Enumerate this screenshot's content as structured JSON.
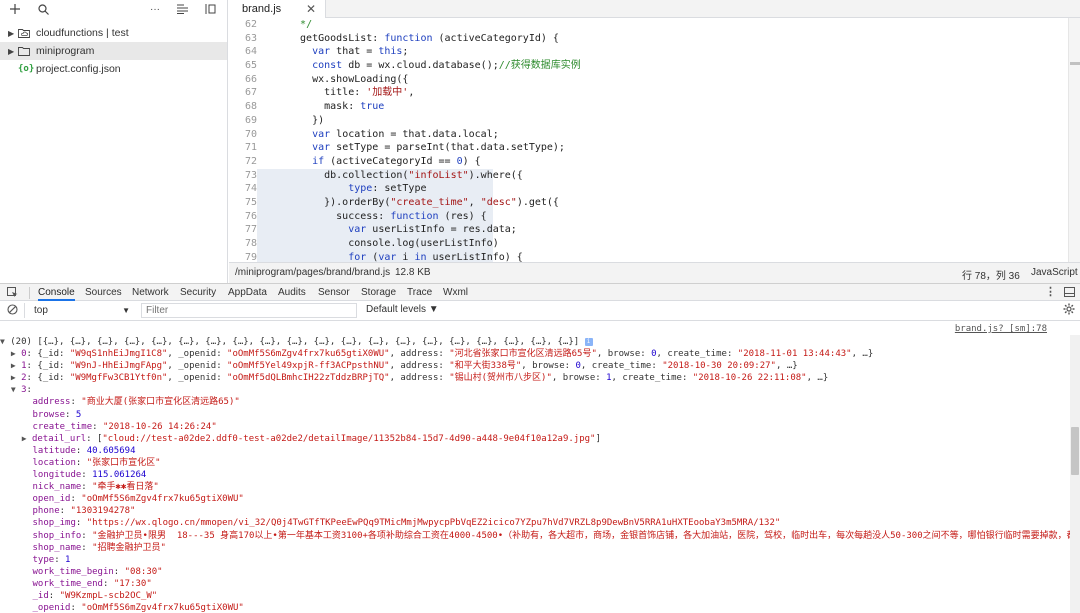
{
  "sidebar": {
    "tree": [
      {
        "label": "cloudfunctions | test"
      },
      {
        "label": "miniprogram"
      },
      {
        "label": "project.config.json"
      }
    ]
  },
  "editor": {
    "tab_label": "brand.js",
    "lines": [
      {
        "n": "62",
        "html": "  <span class='cmt'>*/</span>"
      },
      {
        "n": "63",
        "html": "  getGoodsList: <span class='kw'>function</span> (activeCategoryId) {"
      },
      {
        "n": "64",
        "html": "    <span class='kw'>var</span> that = <span class='kw'>this</span>;"
      },
      {
        "n": "65",
        "html": "    <span class='kw'>const</span> db = wx.cloud.database();<span class='cmt'>//获得数据库实例</span>"
      },
      {
        "n": "66",
        "html": "    wx.showLoading({"
      },
      {
        "n": "67",
        "html": "      title: <span class='str'>'加载中'</span>,"
      },
      {
        "n": "68",
        "html": "      mask: <span class='kw'>true</span>"
      },
      {
        "n": "69",
        "html": "    })"
      },
      {
        "n": "70",
        "html": "    <span class='kw'>var</span> location = that.data.local;"
      },
      {
        "n": "71",
        "html": "    <span class='kw'>var</span> setType = parseInt(that.data.setType);"
      },
      {
        "n": "72",
        "html": "    <span class='kw'>if</span> (activeCategoryId == <span class='num'>0</span>) {"
      },
      {
        "n": "73",
        "html": "      db.collection(<span class='str'>\"infoList\"</span>).where({",
        "hl": true
      },
      {
        "n": "74",
        "html": "          <span class='kw'>type</span>: setType",
        "hl": true
      },
      {
        "n": "75",
        "html": "      }).orderBy(<span class='str'>\"create_time\"</span>, <span class='str'>\"desc\"</span>).get({",
        "hl": true
      },
      {
        "n": "76",
        "html": "        success: <span class='kw'>function</span> (res) {",
        "hl": true
      },
      {
        "n": "77",
        "html": "          <span class='kw'>var</span> userListInfo = res.data;",
        "hl": true
      },
      {
        "n": "78",
        "html": "          console.log(userListInfo)",
        "hl": true
      },
      {
        "n": "79",
        "html": "          <span class='kw'>for</span> (<span class='kw'>var</span> i <span class='kw'>in</span> userListInfo) {",
        "hl": true
      }
    ]
  },
  "statusbar": {
    "path": "/miniprogram/pages/brand/brand.js",
    "size": "12.8 KB",
    "position": "行 78，列 36",
    "language": "JavaScript"
  },
  "devtools": {
    "tabs": [
      "Console",
      "Sources",
      "Network",
      "Security",
      "AppData",
      "Audits",
      "Sensor",
      "Storage",
      "Trace",
      "Wxml"
    ],
    "context": "top",
    "filter_placeholder": "Filter",
    "levels": "Default levels ▼",
    "source_link": "brand.js? [sm]:78"
  },
  "console": {
    "lines": [
      {
        "html": "<span class='tri'>▼</span> (20) [{…}, {…}, {…}, {…}, {…}, {…}, {…}, {…}, {…}, {…}, {…}, {…}, {…}, {…}, {…}, {…}, {…}, {…}, {…}, {…}] <span class='infobadge'>i</span>"
      },
      {
        "html": "  <span class='tri'>▶</span> <span class='ckey'>0</span>: {_id: <span class='cstr'>\"W9qS1nhEiJmgI1C8\"</span>, _openid: <span class='cstr'>\"oOmMf5S6mZgv4frx7ku65gtiX0WU\"</span>, address: <span class='cstr'>\"河北省张家口市宣化区清远路65号\"</span>, browse: <span class='cnum'>0</span>, create_time: <span class='cstr'>\"2018-11-01 13:44:43\"</span>, …}"
      },
      {
        "html": "  <span class='tri'>▶</span> <span class='ckey'>1</span>: {_id: <span class='cstr'>\"W9nJ-HhEiJmgFApg\"</span>, _openid: <span class='cstr'>\"oOmMf5Yel49xpjR-ff3ACPpsthNU\"</span>, address: <span class='cstr'>\"和平大街338号\"</span>, browse: <span class='cnum'>0</span>, create_time: <span class='cstr'>\"2018-10-30 20:09:27\"</span>, …}"
      },
      {
        "html": "  <span class='tri'>▶</span> <span class='ckey'>2</span>: {_id: <span class='cstr'>\"W9MgfFw3CB1Ytf0n\"</span>, _openid: <span class='cstr'>\"oOmMf5dQLBmhcIH22zTddzBRPjTQ\"</span>, address: <span class='cstr'>\"锡山村(贺州市八步区)\"</span>, browse: <span class='cnum'>1</span>, create_time: <span class='cstr'>\"2018-10-26 22:11:08\"</span>, …}"
      },
      {
        "html": "  <span class='tri'>▼</span> <span class='ckey'>3</span>:"
      },
      {
        "html": "      <span class='ckey'>address</span>: <span class='cstr'>\"商业大厦(张家口市宣化区清远路65)\"</span>"
      },
      {
        "html": "      <span class='ckey'>browse</span>: <span class='cnum'>5</span>"
      },
      {
        "html": "      <span class='ckey'>create_time</span>: <span class='cstr'>\"2018-10-26 14:26:24\"</span>"
      },
      {
        "html": "    <span class='tri'>▶</span> <span class='ckey'>detail_url</span>: [<span class='cstr'>\"cloud://test-a02de2.ddf0-test-a02de2/detailImage/11352b84-15d7-4d90-a448-9e04f10a12a9.jpg\"</span>]"
      },
      {
        "html": "      <span class='ckey'>latitude</span>: <span class='cnum'>40.605694</span>"
      },
      {
        "html": "      <span class='ckey'>location</span>: <span class='cstr'>\"张家口市宣化区\"</span>"
      },
      {
        "html": "      <span class='ckey'>longitude</span>: <span class='cnum'>115.061264</span>"
      },
      {
        "html": "      <span class='ckey'>nick_name</span>: <span class='cstr'>\"牵手✱✱看日落\"</span>"
      },
      {
        "html": "      <span class='ckey'>open_id</span>: <span class='cstr'>\"oOmMf5S6mZgv4frx7ku65gtiX0WU\"</span>"
      },
      {
        "html": "      <span class='ckey'>phone</span>: <span class='cstr'>\"1303194278\"</span>"
      },
      {
        "html": "      <span class='ckey'>shop_img</span>: <span class='cstr'>\"https://wx.qlogo.cn/mmopen/vi_32/Q0j4TwGTfTKPeeEwPQq9TMicMmjMwpycpPbVqEZ2icico7YZpu7hVd7VRZL8p9DewBnV5RRA1uHXTEoobaY3m5MRA/132\"</span>"
      },
      {
        "html": "      <span class='ckey'>shop_info</span>: <span class='cstr'>\"金融护卫员•限男  18---35 身高170以上•第一年基本工资3100+各项补助综合工资在4000-4500•（补助有，各大超市，商场，金银首饰店铺，各大加油站，医院，驾校，临时出车，每次每趟没人50-300之间不等，哪怕银行临时需要掉款，都</span>"
      },
      {
        "html": "      <span class='ckey'>shop_name</span>: <span class='cstr'>\"招聘金融护卫员\"</span>"
      },
      {
        "html": "      <span class='ckey'>type</span>: <span class='cnum'>1</span>"
      },
      {
        "html": "      <span class='ckey'>work_time_begin</span>: <span class='cstr'>\"08:30\"</span>"
      },
      {
        "html": "      <span class='ckey'>work_time_end</span>: <span class='cstr'>\"17:30\"</span>"
      },
      {
        "html": "      <span class='ckey'>_id</span>: <span class='cstr'>\"W9KzmpL-scb2OC_W\"</span>"
      },
      {
        "html": "      <span class='ckey'>_openid</span>: <span class='cstr'>\"oOmMf5S6mZgv4frx7ku65gtiX0WU\"</span>"
      }
    ]
  }
}
